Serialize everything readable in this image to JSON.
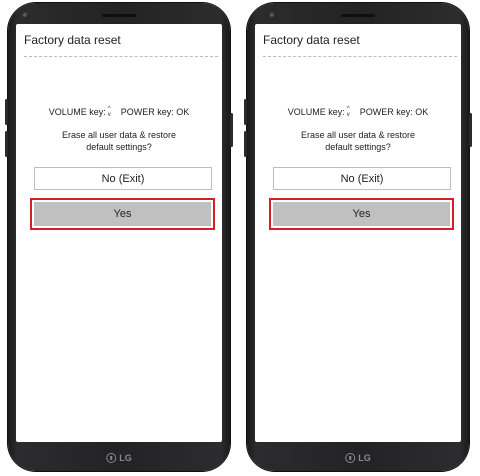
{
  "screens": [
    {
      "title": "Factory data reset",
      "volume_key_label": "VOLUME key:",
      "volume_key_arrows": [
        "^",
        "v"
      ],
      "power_key_label": "POWER key: OK",
      "prompt_line1": "Erase all user data & restore",
      "prompt_line2": "default settings?",
      "no_button": "No (Exit)",
      "yes_button": "Yes",
      "brand": "LG"
    },
    {
      "title": "Factory data reset",
      "volume_key_label": "VOLUME key:",
      "volume_key_arrows": [
        "^",
        "v"
      ],
      "power_key_label": "POWER key: OK",
      "prompt_line1": "Erase all user data & restore",
      "prompt_line2": "default settings?",
      "no_button": "No (Exit)",
      "yes_button": "Yes",
      "brand": "LG"
    }
  ],
  "colors": {
    "highlight_border": "#d0212a",
    "yes_fill": "#c0c0c0",
    "phone_body": "#232325"
  }
}
